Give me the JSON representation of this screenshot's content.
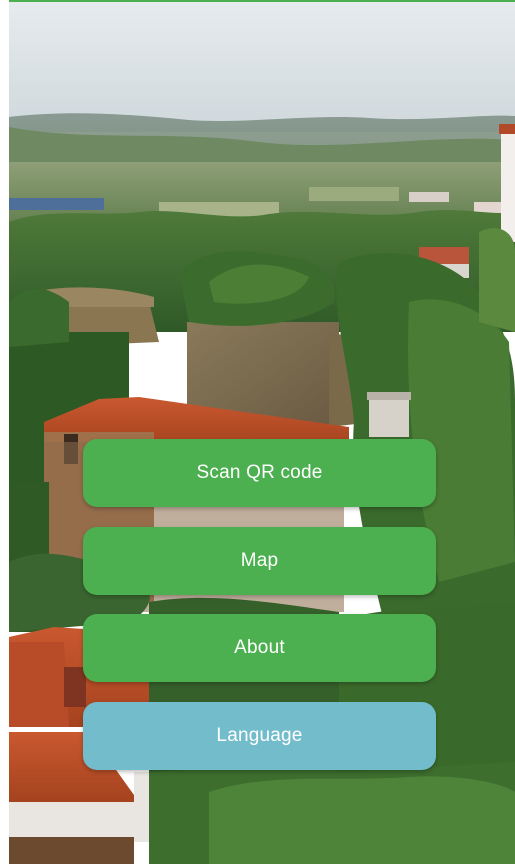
{
  "background": {
    "description_icon": "village-landscape-photo"
  },
  "colors": {
    "accent_green": "#4cb050",
    "language_blue": "#72bccb",
    "text": "#ffffff"
  },
  "menu": {
    "scan_label": "Scan QR code",
    "map_label": "Map",
    "about_label": "About",
    "language_label": "Language"
  }
}
